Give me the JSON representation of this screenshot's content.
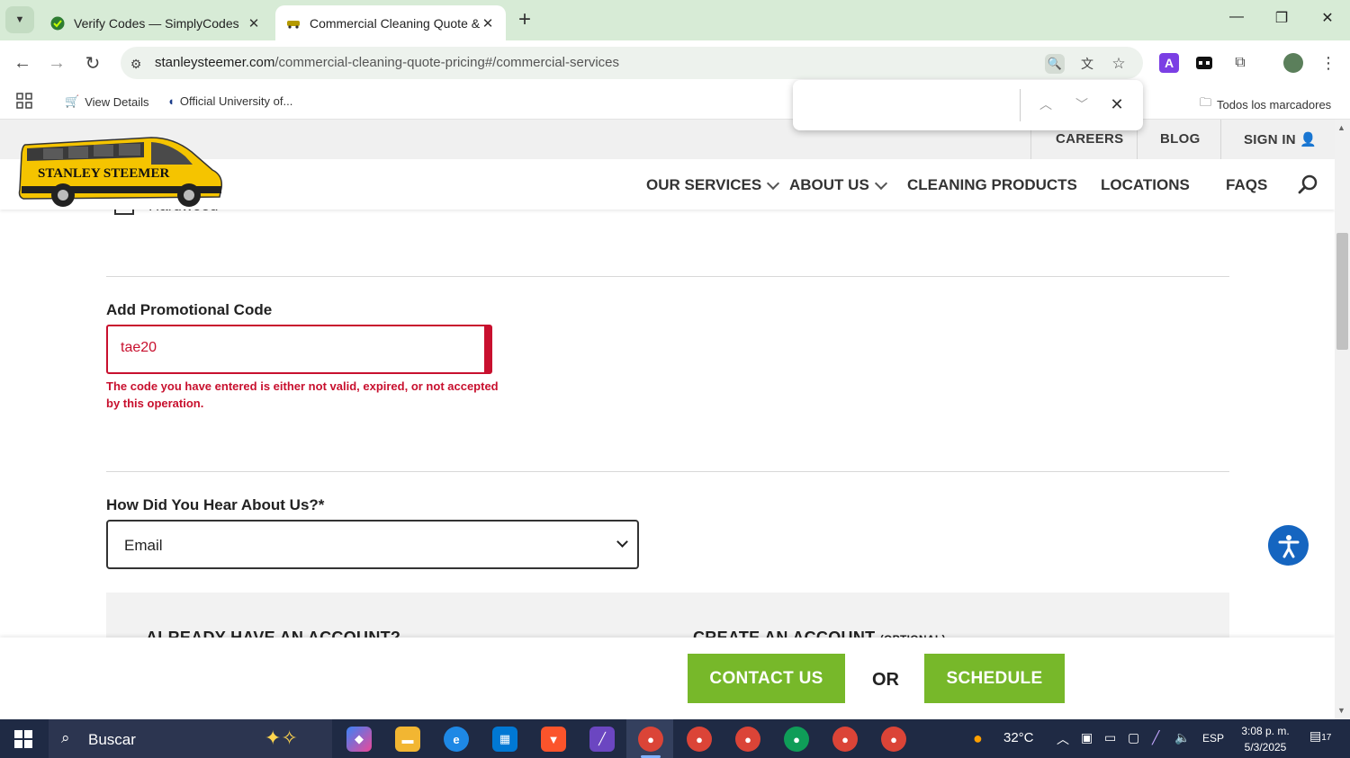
{
  "browser": {
    "tabs": [
      {
        "title": "Verify Codes — SimplyCodes",
        "active": false
      },
      {
        "title": "Commercial Cleaning Quote & I",
        "active": true
      }
    ],
    "url_host": "stanleysteemer.com",
    "url_path": "/commercial-cleaning-quote-pricing#/commercial-services",
    "bookmarks": [
      {
        "label": "View Details"
      },
      {
        "label": "Official University of..."
      }
    ],
    "all_bookmarks_label": "Todos los marcadores"
  },
  "site": {
    "logo_text": "STANLEY STEEMER",
    "top_links": [
      "CAREERS",
      "BLOG",
      "SIGN IN"
    ],
    "nav": [
      {
        "label": "OUR SERVICES",
        "dropdown": true
      },
      {
        "label": "ABOUT US",
        "dropdown": true
      },
      {
        "label": "CLEANING PRODUCTS",
        "dropdown": false
      },
      {
        "label": "LOCATIONS",
        "dropdown": false
      },
      {
        "label": "FAQS",
        "dropdown": false
      }
    ]
  },
  "form": {
    "partial_checkbox_label": "Hardwood",
    "promo": {
      "label": "Add Promotional Code",
      "value": "tae20",
      "error": "The code you have entered is either not valid, expired, or not accepted by this operation."
    },
    "hear": {
      "label": "How Did You Hear About Us?*",
      "selected": "Email"
    },
    "account": {
      "existing_heading": "ALREADY HAVE AN ACCOUNT?",
      "create_heading": "CREATE AN ACCOUNT",
      "create_note": "(OPTIONAL)"
    }
  },
  "cta": {
    "contact": "CONTACT US",
    "or": "OR",
    "schedule": "SCHEDULE"
  },
  "taskbar": {
    "search_placeholder": "Buscar",
    "weather": "32°C",
    "language": "ESP",
    "time": "3:08 p. m.",
    "date": "5/3/2025",
    "notifications": "17"
  },
  "colors": {
    "error_red": "#c8102e",
    "cta_green": "#77b82a",
    "logo_yellow": "#f5c400",
    "tab_bar": "#d7ebd6"
  }
}
